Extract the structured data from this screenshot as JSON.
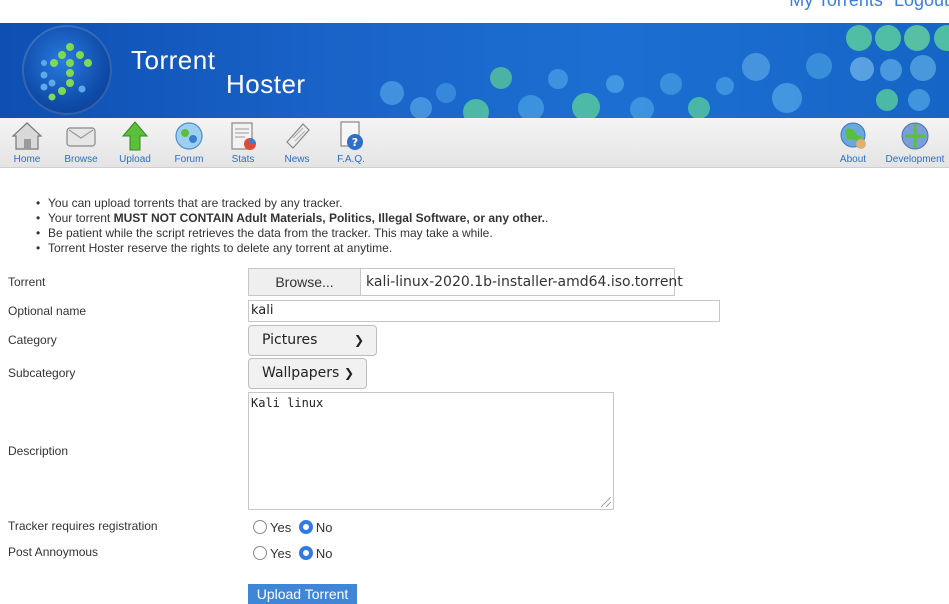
{
  "top_links": {
    "my_torrents": "My Torrents",
    "logout": "Logout"
  },
  "banner": {
    "title_line1": "Torrent",
    "title_line2": "Hoster"
  },
  "nav": {
    "items": [
      {
        "label": "Home",
        "icon": "home-icon"
      },
      {
        "label": "Browse",
        "icon": "browse-icon"
      },
      {
        "label": "Upload",
        "icon": "upload-icon"
      },
      {
        "label": "Forum",
        "icon": "forum-icon"
      },
      {
        "label": "Stats",
        "icon": "stats-icon"
      },
      {
        "label": "News",
        "icon": "news-icon"
      },
      {
        "label": "F.A.Q.",
        "icon": "faq-icon"
      },
      {
        "label": "About",
        "icon": "about-icon"
      },
      {
        "label": "Development",
        "icon": "development-icon"
      }
    ]
  },
  "notes": {
    "n1": "You can upload torrents that are tracked by any tracker.",
    "n2_prefix": "Your torrent ",
    "n2_bold": "MUST NOT CONTAIN Adult Materials, Politics, Illegal Software, or any other.",
    "n2_suffix": ".",
    "n3": "Be patient while the script retrieves the data from the tracker. This may take a while.",
    "n4": "Torrent Hoster reserve the rights to delete any torrent at anytime."
  },
  "form": {
    "torrent_label": "Torrent",
    "browse_label": "Browse...",
    "file_name": "kali-linux-2020.1b-installer-amd64.iso.torrent",
    "optional_name_label": "Optional name",
    "optional_name_value": "kali",
    "category_label": "Category",
    "category_value": "Pictures",
    "subcategory_label": "Subcategory",
    "subcategory_value": "Wallpapers",
    "description_label": "Description",
    "description_value": "Kali linux",
    "tracker_label": "Tracker requires registration",
    "anon_label": "Post Annoymous",
    "yes": "Yes",
    "no": "No",
    "tracker_selected": "No",
    "anon_selected": "No",
    "submit_label": "Upload Torrent"
  },
  "colors": {
    "accent": "#3f86d8",
    "banner": "#1a63c8",
    "link": "#2a6fc4"
  }
}
